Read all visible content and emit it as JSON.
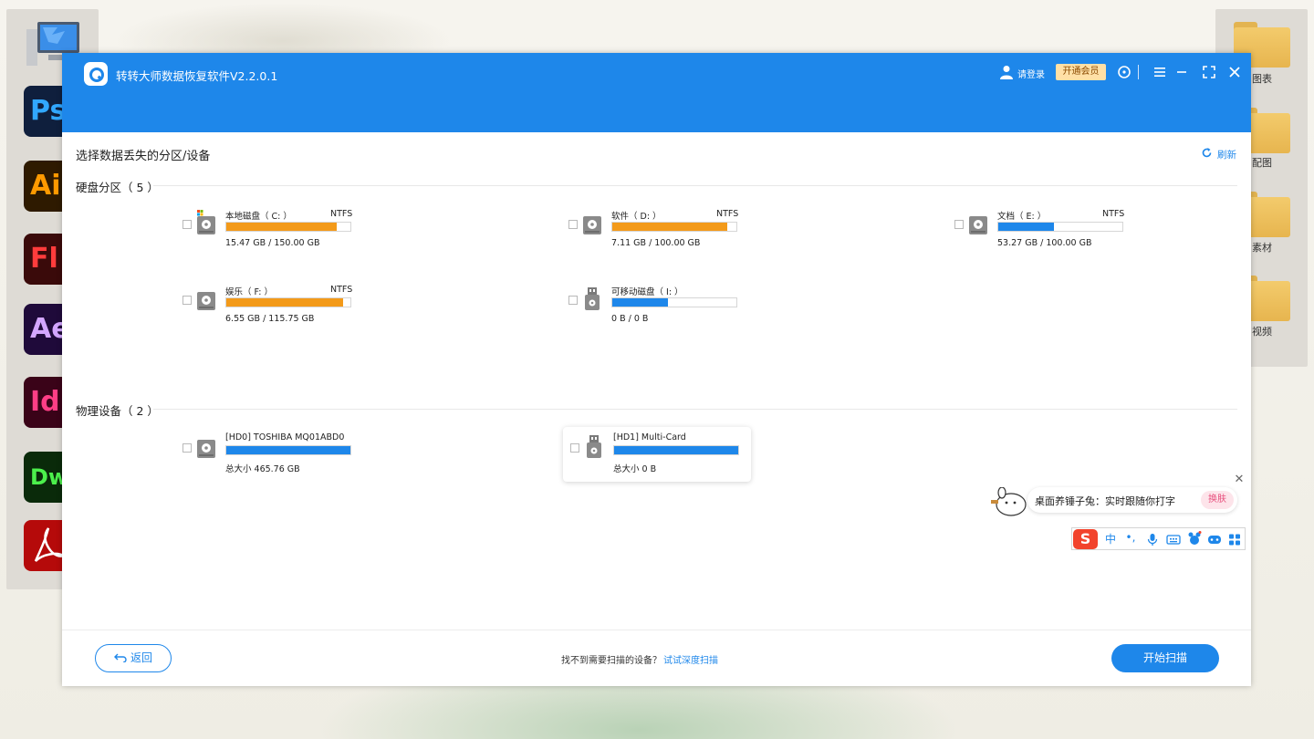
{
  "app": {
    "title": "转转大师数据恢复软件V2.2.0.1",
    "login_label": "请登录",
    "vip_label": "开通会员"
  },
  "page": {
    "section_title": "选择数据丢失的分区/设备",
    "refresh_label": "刷新"
  },
  "partitions": {
    "title": "硬盘分区（ 5 ）",
    "items": [
      {
        "name": "本地磁盘（ C: ）",
        "fs": "NTFS",
        "size": "15.47 GB / 150.00 GB",
        "used_fraction": 0.89,
        "bar_color": "#f39a1a",
        "system": true
      },
      {
        "name": "软件（ D: ）",
        "fs": "NTFS",
        "size": "7.11 GB / 100.00 GB",
        "used_fraction": 0.93,
        "bar_color": "#f39a1a",
        "system": false
      },
      {
        "name": "文档（ E: ）",
        "fs": "NTFS",
        "size": "53.27 GB / 100.00 GB",
        "used_fraction": 0.45,
        "bar_color": "#1e87ea",
        "system": false
      },
      {
        "name": "娱乐（ F: ）",
        "fs": "NTFS",
        "size": "6.55 GB / 115.75 GB",
        "used_fraction": 0.94,
        "bar_color": "#f39a1a",
        "system": false
      },
      {
        "name": "可移动磁盘（ I: ）",
        "fs": "",
        "size": "0 B / 0 B",
        "used_fraction": 0.45,
        "bar_color": "#1e87ea",
        "system": false
      }
    ]
  },
  "devices": {
    "title": "物理设备（ 2 ）",
    "items": [
      {
        "name": "[HD0] TOSHIBA MQ01ABD0",
        "size": "总大小 465.76 GB",
        "used_fraction": 1.0,
        "bar_color": "#1e87ea"
      },
      {
        "name": "[HD1] Multi-Card",
        "size": "总大小 0 B",
        "used_fraction": 1.0,
        "bar_color": "#1e87ea"
      }
    ]
  },
  "footer": {
    "back_label": "返回",
    "hint_text": "找不到需要扫描的设备？",
    "hint_link": "试试深度扫描",
    "scan_label": "开始扫描"
  },
  "ime": {
    "tip_text": "桌面养锤子兔：实时跟随你打字",
    "skin_label": "换肤",
    "logo": "S",
    "mode_label": "中",
    "punct_label": "•,",
    "icons": [
      "mic-icon",
      "keyboard-icon",
      "skin-icon",
      "game-icon",
      "grid-icon"
    ]
  },
  "dock": {
    "left_apps": [
      {
        "label": "Ps",
        "bg": "#0f1f3d",
        "fg": "#31a8ff"
      },
      {
        "label": "Ai",
        "bg": "#2e1a00",
        "fg": "#ff9a00"
      },
      {
        "label": "Fl",
        "bg": "#3a0a0a",
        "fg": "#ff3c3c"
      },
      {
        "label": "Ae",
        "bg": "#1f0a3a",
        "fg": "#d3a6ff"
      },
      {
        "label": "Id",
        "bg": "#3a0318",
        "fg": "#ff3e86"
      },
      {
        "label": "Dw",
        "bg": "#0a2a0a",
        "fg": "#4cf04c"
      }
    ],
    "right_folders": [
      "图表",
      "配图",
      "素材",
      "视频"
    ]
  },
  "colors": {
    "accent": "#1e87ea",
    "orange_bar": "#f39a1a"
  }
}
